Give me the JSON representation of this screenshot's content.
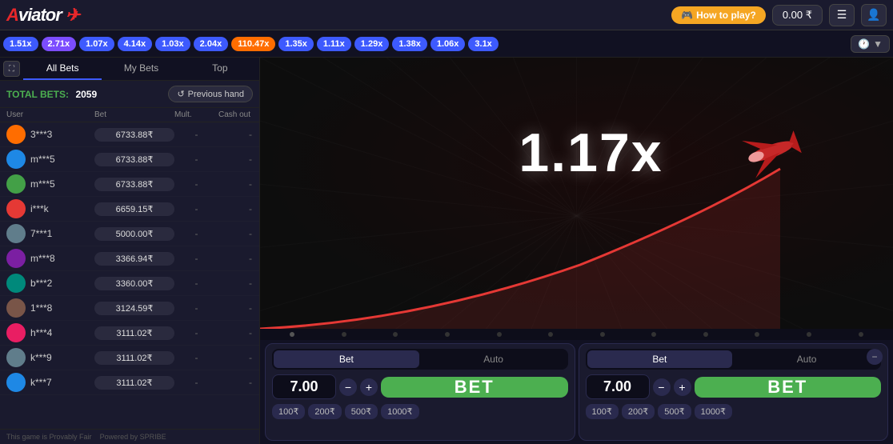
{
  "topbar": {
    "logo": "Aviator",
    "how_to_play": "How to play?",
    "balance": "0.00 ₹"
  },
  "multiplier_row": {
    "items": [
      {
        "value": "1.51x",
        "color": "blue"
      },
      {
        "value": "2.71x",
        "color": "blue"
      },
      {
        "value": "1.07x",
        "color": "blue"
      },
      {
        "value": "4.14x",
        "color": "blue"
      },
      {
        "value": "1.03x",
        "color": "blue"
      },
      {
        "value": "2.04x",
        "color": "blue"
      },
      {
        "value": "110.47x",
        "color": "orange"
      },
      {
        "value": "1.35x",
        "color": "blue"
      },
      {
        "value": "1.11x",
        "color": "blue"
      },
      {
        "value": "1.29x",
        "color": "blue"
      },
      {
        "value": "1.38x",
        "color": "blue"
      },
      {
        "value": "1.06x",
        "color": "blue"
      },
      {
        "value": "3.1x",
        "color": "blue"
      }
    ]
  },
  "left_panel": {
    "tabs": [
      "All Bets",
      "My Bets",
      "Top"
    ],
    "total_bets_label": "TOTAL BETS:",
    "total_bets_count": "2059",
    "prev_hand_label": "Previous hand",
    "columns": [
      "User",
      "Bet",
      "Mult.",
      "Cash out"
    ],
    "bets": [
      {
        "user": "3***3",
        "bet": "6733.88₹",
        "mult": "-",
        "cashout": "-",
        "av_color": "av-orange"
      },
      {
        "user": "m***5",
        "bet": "6733.88₹",
        "mult": "-",
        "cashout": "-",
        "av_color": "av-blue"
      },
      {
        "user": "m***5",
        "bet": "6733.88₹",
        "mult": "-",
        "cashout": "-",
        "av_color": "av-green"
      },
      {
        "user": "i***k",
        "bet": "6659.15₹",
        "mult": "-",
        "cashout": "-",
        "av_color": "av-red"
      },
      {
        "user": "7***1",
        "bet": "5000.00₹",
        "mult": "-",
        "cashout": "-",
        "av_color": "av-gray"
      },
      {
        "user": "m***8",
        "bet": "3366.94₹",
        "mult": "-",
        "cashout": "-",
        "av_color": "av-purple"
      },
      {
        "user": "b***2",
        "bet": "3360.00₹",
        "mult": "-",
        "cashout": "-",
        "av_color": "av-teal"
      },
      {
        "user": "1***8",
        "bet": "3124.59₹",
        "mult": "-",
        "cashout": "-",
        "av_color": "av-brown"
      },
      {
        "user": "h***4",
        "bet": "3111.02₹",
        "mult": "-",
        "cashout": "-",
        "av_color": "av-pink"
      },
      {
        "user": "k***9",
        "bet": "3111.02₹",
        "mult": "-",
        "cashout": "-",
        "av_color": "av-gray"
      },
      {
        "user": "k***7",
        "bet": "3111.02₹",
        "mult": "-",
        "cashout": "-",
        "av_color": "av-blue"
      }
    ],
    "provably_fair": "This game is  Provably Fair",
    "powered_by": "Powered by SPRIBE"
  },
  "game": {
    "multiplier": "1.17x"
  },
  "bet_panels": [
    {
      "tabs": [
        "Bet",
        "Auto"
      ],
      "active_tab": "Bet",
      "amount": "7.00",
      "quick_amounts": [
        "100₹",
        "200₹",
        "500₹",
        "1000₹"
      ],
      "bet_label": "BET"
    },
    {
      "tabs": [
        "Bet",
        "Auto"
      ],
      "active_tab": "Bet",
      "amount": "7.00",
      "quick_amounts": [
        "100₹",
        "200₹",
        "500₹",
        "1000₹"
      ],
      "bet_label": "BET"
    }
  ],
  "dots": [
    0,
    1,
    2,
    3,
    4,
    5,
    6,
    7,
    8,
    9,
    10,
    11
  ]
}
